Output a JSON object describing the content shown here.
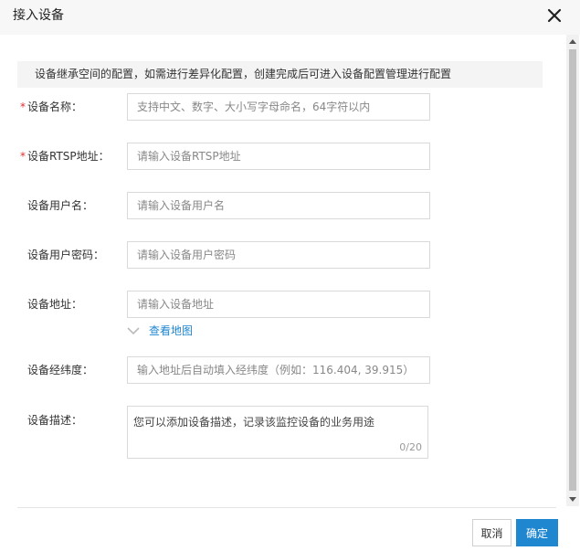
{
  "dialog": {
    "title": "接入设备"
  },
  "notice": "设备继承空间的配置，如需进行差异化配置，创建完成后可进入设备配置管理进行配置",
  "form": {
    "name": {
      "label": "设备名称：",
      "placeholder": "支持中文、数字、大小写字母命名，64字符以内",
      "required": true
    },
    "rtsp": {
      "label": "设备RTSP地址：",
      "placeholder": "请输入设备RTSP地址",
      "required": true
    },
    "username": {
      "label": "设备用户名：",
      "placeholder": "请输入设备用户名"
    },
    "password": {
      "label": "设备用户密码：",
      "placeholder": "请输入设备用户密码"
    },
    "address": {
      "label": "设备地址：",
      "placeholder": "请输入设备地址"
    },
    "map_link": "查看地图",
    "coords": {
      "label": "设备经纬度：",
      "placeholder": "输入地址后自动填入经纬度（例如：116.404, 39.915）"
    },
    "description": {
      "label": "设备描述：",
      "placeholder": "您可以添加设备描述，记录该监控设备的业务用途",
      "counter": "0/20"
    }
  },
  "footer": {
    "cancel": "取消",
    "ok": "确定"
  },
  "required_mark": "*",
  "colors": {
    "accent": "#1f86d0",
    "required": "#e0312f"
  },
  "icons": {
    "close": "close-icon",
    "map_toggle": "chevron-down-icon",
    "scroll_up": "arrow-up-icon",
    "scroll_down": "arrow-down-icon"
  }
}
